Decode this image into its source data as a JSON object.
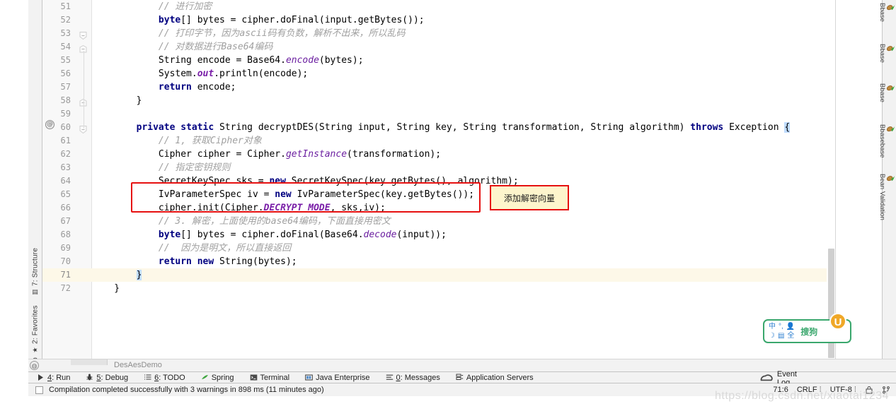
{
  "editor": {
    "first_line": 51,
    "current_line": 71,
    "lines": [
      {
        "n": 51,
        "html": "            <i class='cmt'>// 进行加密</i>"
      },
      {
        "n": 52,
        "html": "            <b class='kw'>byte</b>[] bytes = cipher.doFinal(input.getBytes());"
      },
      {
        "n": 53,
        "html": "            <i class='cmt'>// 打印字节，因为ascii码有负数，解析不出来，所以乱码</i>"
      },
      {
        "n": 54,
        "html": "            <i class='cmt'>// 对数据进行Base64编码</i>"
      },
      {
        "n": 55,
        "html": "            String encode = Base64.<i class='stat'>encode</i>(bytes);"
      },
      {
        "n": 56,
        "html": "            System.<i class='cnst'>out</i>.println(encode);"
      },
      {
        "n": 57,
        "html": "            <b class='kw'>return</b> encode;"
      },
      {
        "n": 58,
        "html": "        }"
      },
      {
        "n": 59,
        "html": ""
      },
      {
        "n": 60,
        "html": "        <b class='kw'>private static</b> String decryptDES(String input, String key, String transformation, String algorithm) <b class='kw'>throws</b> Exception <span class='brace-hl'>{</span>"
      },
      {
        "n": 61,
        "html": "            <i class='cmt'>// 1, 获取Cipher对象</i>"
      },
      {
        "n": 62,
        "html": "            Cipher cipher = Cipher.<i class='stat'>getInstance</i>(transformation);"
      },
      {
        "n": 63,
        "html": "            <i class='cmt'>// 指定密钥规则</i>"
      },
      {
        "n": 64,
        "html": "            SecretKeySpec sks = <b class='kw'>new</b> SecretKeySpec(key.getBytes(), algorithm);"
      },
      {
        "n": 65,
        "html": "            IvParameterSpec iv = <b class='kw'>new</b> IvParameterSpec(key.getBytes());"
      },
      {
        "n": 66,
        "html": "            cipher.init(Cipher.<i class='cnst'>DECRYPT_MODE</i>, sks,iv);"
      },
      {
        "n": 67,
        "html": "            <i class='cmt'>// 3. 解密，上面使用的base64编码，下面直接用密文</i>"
      },
      {
        "n": 68,
        "html": "            <b class='kw'>byte</b>[] bytes = cipher.doFinal(Base64.<i class='stat'>decode</i>(input));"
      },
      {
        "n": 69,
        "html": "            <i class='cmt'>//  因为是明文，所以直接返回</i>"
      },
      {
        "n": 70,
        "html": "            <b class='kw'>return new</b> String(bytes);"
      },
      {
        "n": 71,
        "html": "        <span class='brace-hl'>}</span>"
      },
      {
        "n": 72,
        "html": "    }"
      }
    ]
  },
  "annotation": {
    "note_text": "添加解密向量",
    "box_color": "#e61010",
    "note_bg": "#fdf5cc"
  },
  "left_tabs": [
    {
      "label": "7: Structure",
      "icon": "structure-icon",
      "glyph": "▥"
    },
    {
      "label": "2: Favorites",
      "icon": "star-icon",
      "glyph": "★"
    },
    {
      "label": "Web",
      "icon": "globe-icon",
      "glyph": "◍"
    }
  ],
  "right_tabs": [
    {
      "label": "Bbase",
      "icon": "bean-icon"
    },
    {
      "label": "Bbase",
      "icon": "bean-icon"
    },
    {
      "label": "Bbase",
      "icon": "bean-icon"
    },
    {
      "label": "Bbasebase",
      "icon": "bean-icon"
    },
    {
      "label": "Bean Validation",
      "icon": "bean-icon"
    }
  ],
  "breadcrumb": {
    "icon": "globe-icon",
    "text": "DesAesDemo"
  },
  "tool_window_bar": {
    "buttons": [
      {
        "icon": "play-icon",
        "num": "4",
        "label": ": Run"
      },
      {
        "icon": "bug-icon",
        "num": "5",
        "label": ": Debug"
      },
      {
        "icon": "list-icon",
        "num": "6",
        "label": ": TODO"
      },
      {
        "icon": "spring-icon",
        "num": "",
        "label": "Spring"
      },
      {
        "icon": "terminal-icon",
        "num": "",
        "label": "Terminal"
      },
      {
        "icon": "java-ee-icon",
        "num": "",
        "label": "Java Enterprise"
      },
      {
        "icon": "messages-icon",
        "num": "0",
        "label": ": Messages"
      },
      {
        "icon": "server-icon",
        "num": "",
        "label": "Application Servers"
      }
    ],
    "event_log": "Event Log",
    "event_log_icon": "event-log-icon"
  },
  "status_bar": {
    "message": "Compilation completed successfully with 3 warnings in 898 ms (11 minutes ago)",
    "caret": "71:6",
    "line_sep": "CRLF",
    "encoding": "UTF-8",
    "lock_icon": "lock-icon",
    "vcs_icon": "branch-icon"
  },
  "ime": {
    "mode": "中",
    "punct": "°,",
    "moon": "☽",
    "keyboard": "▤",
    "width_mode": "全",
    "user_icon": "user-icon",
    "brand": "搜狗",
    "logo_letter": "U",
    "accent": "#3aa76d"
  },
  "watermark": "https://blog.csdn.net/xiaotai1234"
}
